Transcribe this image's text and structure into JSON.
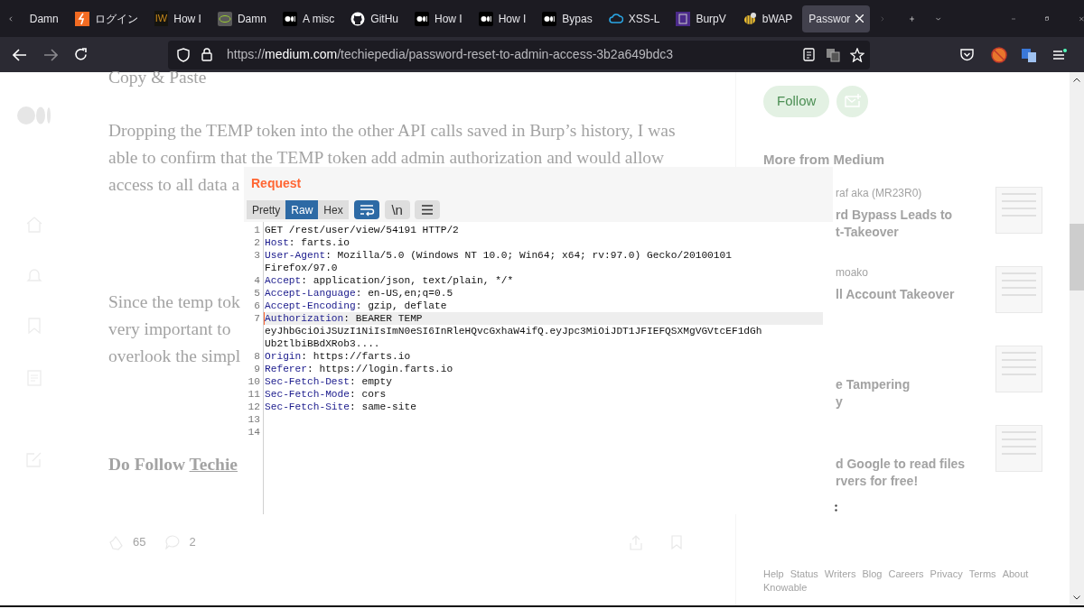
{
  "browser": {
    "tabs": [
      {
        "label": "Damn",
        "selected": false
      },
      {
        "label": "ログイン",
        "selected": false
      },
      {
        "favicon_text": "IW",
        "label": "How I",
        "selected": false
      },
      {
        "label": "Damn",
        "selected": false
      },
      {
        "label": "A misc",
        "selected": false
      },
      {
        "label": "GitHu",
        "selected": false
      },
      {
        "label": "How I",
        "selected": false
      },
      {
        "label": "How I",
        "selected": false
      },
      {
        "label": "Bypas",
        "selected": false
      },
      {
        "label": "XSS-L",
        "selected": false
      },
      {
        "label": "BurpV",
        "selected": false
      },
      {
        "label": "bWAP",
        "selected": false
      },
      {
        "label": "Passwor",
        "selected": true
      }
    ],
    "url": {
      "scheme": "https://",
      "host": "medium.com",
      "path": "/techiepedia/password-reset-to-admin-access-3b2a649bdc3"
    }
  },
  "article": {
    "section_title": "Copy & Paste",
    "paragraphs": [
      [
        "Dropping the TEMP token into the other API calls saved in Burp’s history, I was",
        "able to confirm that the TEMP token add admin authorization and would allow",
        "access to all data a"
      ],
      [
        "Since the temp tok",
        "very important to",
        "overlook the simpl"
      ]
    ],
    "closing": {
      "text": "Do Follow",
      "link": "Techie"
    },
    "claps": "65",
    "comments": "2"
  },
  "sidebar": {
    "follow_label": "Follow",
    "more_heading": "More from Medium",
    "stories": [
      {
        "author": "raf aka (MR23R0)",
        "title_lines": [
          "rd Bypass Leads to",
          "t-Takeover"
        ]
      },
      {
        "author": "moako",
        "title_lines": [
          "ll Account Takeover"
        ]
      },
      {
        "title_lines": [
          "e Tampering",
          "y"
        ]
      },
      {
        "title_lines": [
          "d Google to read files",
          "rvers for free!"
        ]
      }
    ],
    "footer_links": [
      "Help",
      "Status",
      "Writers",
      "Blog",
      "Careers",
      "Privacy",
      "Terms",
      "About",
      "Knowable"
    ]
  },
  "request_panel": {
    "title": "Request",
    "view_tabs": [
      {
        "label": "Pretty",
        "selected": false
      },
      {
        "label": "Raw",
        "selected": true
      },
      {
        "label": "Hex",
        "selected": false
      }
    ],
    "wrap_active": true,
    "newline_label": "\\n",
    "lines": [
      {
        "number": "1",
        "value": "GET /rest/user/view/54191 HTTP/2",
        "highlighted": false
      },
      {
        "number": "2",
        "key": "Host",
        "value": ": farts.io",
        "highlighted": false
      },
      {
        "number": "3",
        "key": "User-Agent",
        "value": ": Mozilla/5.0 (Windows NT 10.0; Win64; x64; rv:97.0) Gecko/20100101",
        "continuation": [
          "Firefox/97.0"
        ],
        "highlighted": false
      },
      {
        "number": "4",
        "key": "Accept",
        "value": ": application/json, text/plain, */*",
        "highlighted": false
      },
      {
        "number": "5",
        "key": "Accept-Language",
        "value": ": en-US,en;q=0.5",
        "highlighted": false
      },
      {
        "number": "6",
        "key": "Accept-Encoding",
        "value": ": gzip, deflate",
        "highlighted": false
      },
      {
        "number": "7",
        "key": "Authorization",
        "value": ": BEARER TEMP",
        "continuation": [
          "eyJhbGciOiJSUzI1NiIsImN0eSI6InRleHQvcGxhaW4ifQ.eyJpc3MiOiJDT1JFIEFQSXMgVGVtcEF1dGh",
          "Ub2tlbiBBdXRob3...."
        ],
        "highlighted": true
      },
      {
        "number": "8",
        "key": "Origin",
        "value": ": https://farts.io",
        "highlighted": false
      },
      {
        "number": "9",
        "key": "Referer",
        "value": ": https://login.farts.io",
        "highlighted": false
      },
      {
        "number": "10",
        "key": "Sec-Fetch-Dest",
        "value": ": empty",
        "highlighted": false
      },
      {
        "number": "11",
        "key": "Sec-Fetch-Mode",
        "value": ": cors",
        "highlighted": false
      },
      {
        "number": "12",
        "key": "Sec-Fetch-Site",
        "value": ": same-site",
        "highlighted": false
      },
      {
        "number": "13",
        "highlighted": false
      },
      {
        "number": "14",
        "highlighted": false
      }
    ]
  }
}
